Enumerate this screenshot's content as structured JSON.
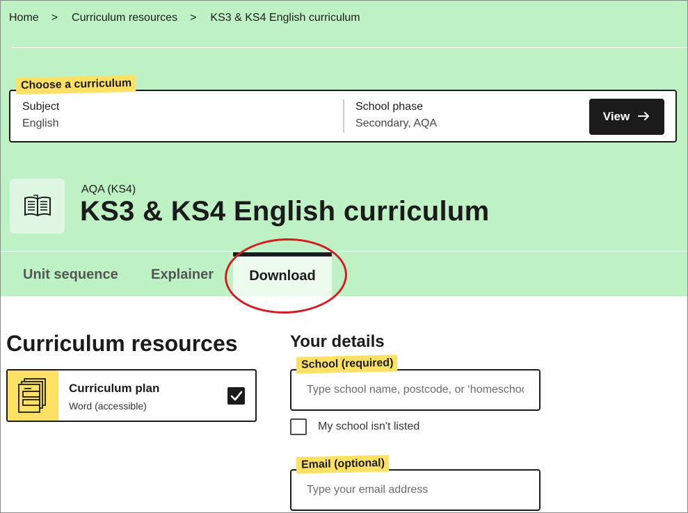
{
  "breadcrumb": {
    "items": [
      "Home",
      "Curriculum resources",
      "KS3 & KS4 English curriculum"
    ],
    "separator": ">"
  },
  "chooser": {
    "tag": "Choose a curriculum",
    "subject_label": "Subject",
    "subject_value": "English",
    "phase_label": "School phase",
    "phase_value": "Secondary, AQA",
    "view_button": "View",
    "view_icon": "arrow-right-icon"
  },
  "header": {
    "icon": "open-book-icon",
    "subtitle": "AQA (KS4)",
    "title": "KS3 & KS4 English curriculum"
  },
  "tabs": [
    {
      "label": "Unit sequence",
      "active": false
    },
    {
      "label": "Explainer",
      "active": false
    },
    {
      "label": "Download",
      "active": true
    }
  ],
  "annotation": {
    "type": "red-circle",
    "target": "Download",
    "color": "#d21b22"
  },
  "resources": {
    "title": "Curriculum resources",
    "items": [
      {
        "name": "Curriculum plan",
        "format": "Word (accessible)",
        "checked": true,
        "icon": "document-stack-icon"
      }
    ]
  },
  "details": {
    "title": "Your details",
    "school_label": "School (required)",
    "school_placeholder": "Type school name, postcode, or ‘homeschool’",
    "not_listed_label": "My school isn't listed",
    "not_listed_checked": false,
    "email_label": "Email (optional)",
    "email_placeholder": "Type your email address"
  },
  "colors": {
    "hero_bg": "#bef2c4",
    "tag_yellow": "#fde164",
    "dark": "#1b1b1b",
    "annotation_red": "#d21b22"
  }
}
